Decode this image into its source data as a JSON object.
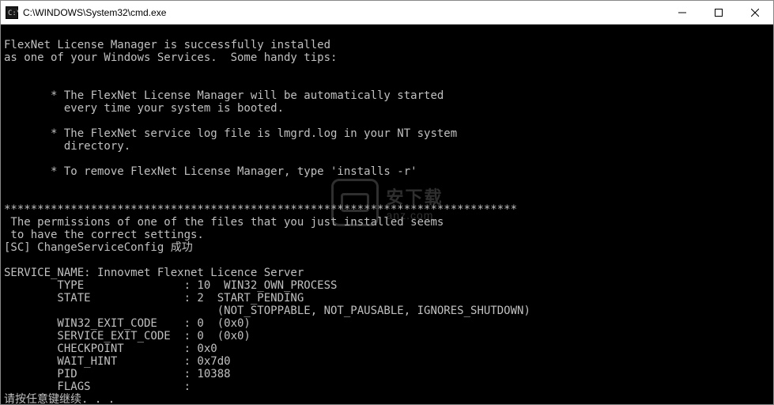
{
  "window": {
    "title": "C:\\WINDOWS\\System32\\cmd.exe"
  },
  "terminal": {
    "lines": [
      "",
      "FlexNet License Manager is successfully installed",
      "as one of your Windows Services.  Some handy tips:",
      "",
      "",
      "       * The FlexNet License Manager will be automatically started",
      "         every time your system is booted.",
      "",
      "       * The FlexNet service log file is lmgrd.log in your NT system",
      "         directory.",
      "",
      "       * To remove FlexNet License Manager, type 'installs -r'",
      "",
      "",
      "*****************************************************************************",
      " The permissions of one of the files that you just installed seems",
      " to have the correct settings.",
      "[SC] ChangeServiceConfig 成功",
      "",
      "SERVICE_NAME: Innovmet Flexnet Licence Server",
      "        TYPE               : 10  WIN32_OWN_PROCESS",
      "        STATE              : 2  START_PENDING",
      "                                (NOT_STOPPABLE, NOT_PAUSABLE, IGNORES_SHUTDOWN)",
      "        WIN32_EXIT_CODE    : 0  (0x0)",
      "        SERVICE_EXIT_CODE  : 0  (0x0)",
      "        CHECKPOINT         : 0x0",
      "        WAIT_HINT          : 0x7d0",
      "        PID                : 10388",
      "        FLAGS              :",
      "请按任意键继续. . ."
    ]
  },
  "watermark": {
    "cn": "安下载",
    "en": "anz.com"
  }
}
